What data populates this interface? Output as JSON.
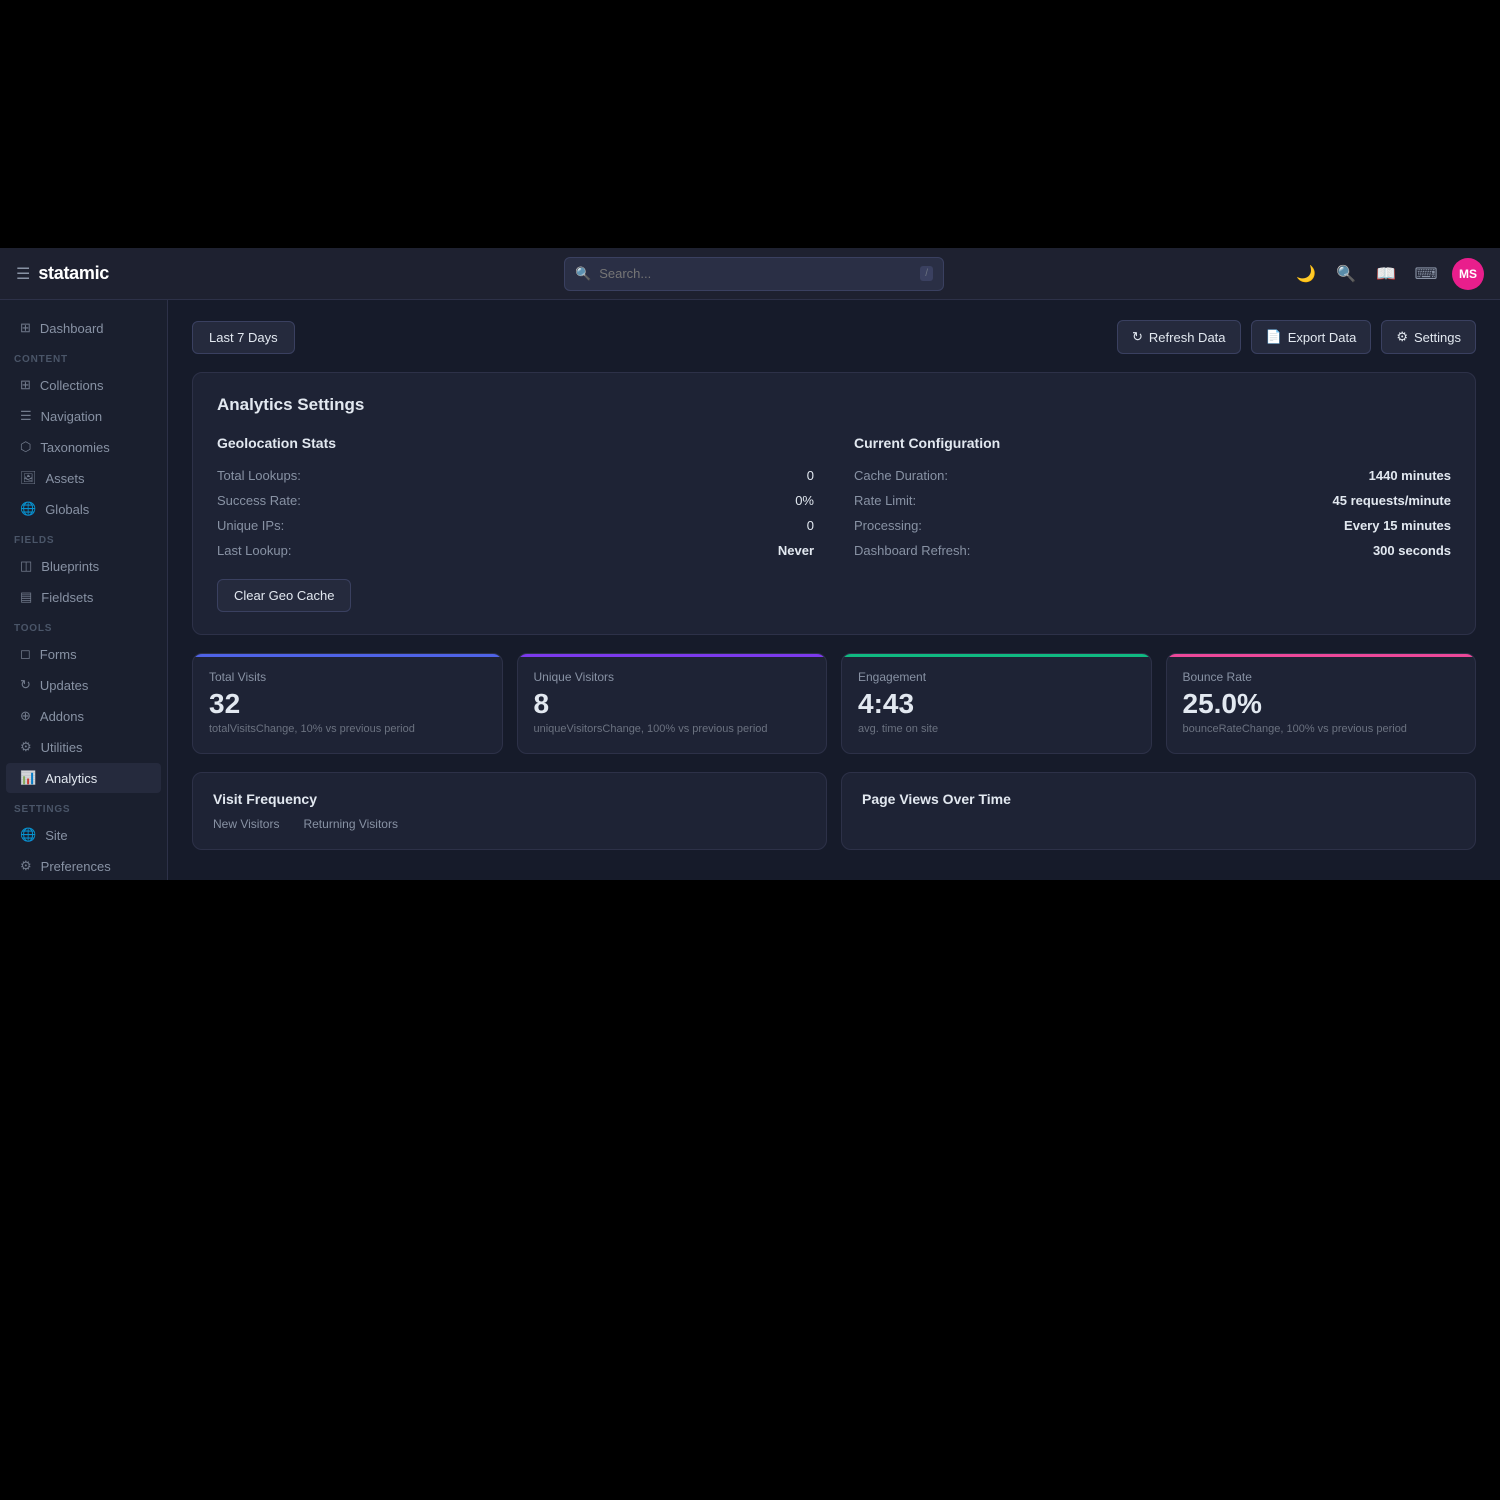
{
  "app": {
    "name": "statamic",
    "avatar_initials": "MS",
    "avatar_bg": "#e91e8c"
  },
  "topbar": {
    "search_placeholder": "Search...",
    "slash_key": "/"
  },
  "sidebar": {
    "dashboard_label": "Dashboard",
    "content_section": "CONTENT",
    "content_items": [
      {
        "id": "collections",
        "label": "Collections",
        "icon": "⊞"
      },
      {
        "id": "navigation",
        "label": "Navigation",
        "icon": "☰"
      },
      {
        "id": "taxonomies",
        "label": "Taxonomies",
        "icon": "⬡"
      },
      {
        "id": "assets",
        "label": "Assets",
        "icon": "🖼"
      },
      {
        "id": "globals",
        "label": "Globals",
        "icon": "🌐"
      }
    ],
    "fields_section": "FIELDS",
    "fields_items": [
      {
        "id": "blueprints",
        "label": "Blueprints",
        "icon": "◫"
      },
      {
        "id": "fieldsets",
        "label": "Fieldsets",
        "icon": "▤"
      }
    ],
    "tools_section": "TOOLS",
    "tools_items": [
      {
        "id": "forms",
        "label": "Forms",
        "icon": "◻"
      },
      {
        "id": "updates",
        "label": "Updates",
        "icon": "↻"
      },
      {
        "id": "addons",
        "label": "Addons",
        "icon": "⊕"
      },
      {
        "id": "utilities",
        "label": "Utilities",
        "icon": "⚙"
      },
      {
        "id": "analytics",
        "label": "Analytics",
        "icon": "📊"
      }
    ],
    "settings_section": "SETTINGS",
    "settings_items": [
      {
        "id": "site",
        "label": "Site",
        "icon": "🌐"
      },
      {
        "id": "preferences",
        "label": "Preferences",
        "icon": "⚙"
      }
    ]
  },
  "toolbar": {
    "date_filter": "Last 7 Days",
    "refresh_label": "Refresh Data",
    "export_label": "Export Data",
    "settings_label": "Settings"
  },
  "analytics_settings": {
    "title": "Analytics Settings",
    "geo_title": "Geolocation Stats",
    "stats": [
      {
        "label": "Total Lookups:",
        "value": "0"
      },
      {
        "label": "Success Rate:",
        "value": "0%"
      },
      {
        "label": "Unique IPs:",
        "value": "0"
      },
      {
        "label": "Last Lookup:",
        "value": "Never"
      }
    ],
    "config_title": "Current Configuration",
    "config": [
      {
        "label": "Cache Duration:",
        "value": "1440 minutes"
      },
      {
        "label": "Rate Limit:",
        "value": "45 requests/minute"
      },
      {
        "label": "Processing:",
        "value": "Every 15 minutes"
      },
      {
        "label": "Dashboard Refresh:",
        "value": "300 seconds"
      }
    ],
    "clear_cache_label": "Clear Geo Cache"
  },
  "metrics": [
    {
      "id": "total-visits",
      "label": "Total Visits",
      "value": "32",
      "sub": "totalVisitsChange, 10% vs previous period",
      "color_class": "blue"
    },
    {
      "id": "unique-visitors",
      "label": "Unique Visitors",
      "value": "8",
      "sub": "uniqueVisitorsChange, 100% vs previous period",
      "color_class": "purple"
    },
    {
      "id": "engagement",
      "label": "Engagement",
      "value": "4:43",
      "sub": "avg. time on site",
      "color_class": "green"
    },
    {
      "id": "bounce-rate",
      "label": "Bounce Rate",
      "value": "25.0%",
      "sub": "bounceRateChange, 100% vs previous period",
      "color_class": "pink"
    }
  ],
  "bottom_cards": [
    {
      "id": "visit-frequency",
      "title": "Visit Frequency",
      "sub_labels": [
        "New Visitors",
        "Returning Visitors"
      ]
    },
    {
      "id": "page-views-over-time",
      "title": "Page Views Over Time",
      "sub_labels": []
    }
  ]
}
